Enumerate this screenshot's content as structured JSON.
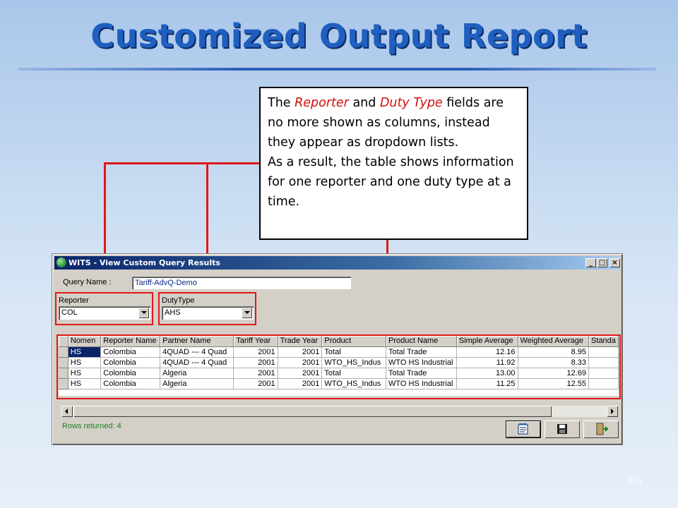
{
  "slide": {
    "title": "Customized Output Report",
    "page_number": "116",
    "callout": {
      "text_1": "The ",
      "red_1": "Reporter",
      "text_2": " and ",
      "red_2": "Duty Type",
      "text_3": " fields are no more shown as columns, instead they appear as dropdown lists.",
      "text_4": "As a result, the table shows information for one reporter and one duty type at a time."
    },
    "accent_colors": {
      "title": "#1f5fbf",
      "highlight_red": "#e01818"
    }
  },
  "window": {
    "title": "WITS - View Custom Query Results",
    "buttons": {
      "minimize": "_",
      "maximize": "□",
      "close": "×"
    },
    "query_name_label": "Query Name :",
    "query_name_value": "Tariff-AdvQ-Demo",
    "reporter": {
      "label": "Reporter",
      "value": "COL"
    },
    "duty_type": {
      "label": "DutyType",
      "value": "AHS"
    },
    "table": {
      "columns": [
        "Nomen",
        "Reporter Name",
        "Partner Name",
        "Tariff Year",
        "Trade Year",
        "Product",
        "Product Name",
        "Simple Average",
        "Weighted Average",
        "Standa"
      ],
      "rows": [
        [
          "HS",
          "Colombia",
          "4QUAD --- 4 Quad",
          "2001",
          "2001",
          " Total",
          "Total Trade",
          "12.16",
          "8.95",
          ""
        ],
        [
          "HS",
          "Colombia",
          "4QUAD --- 4 Quad",
          "2001",
          "2001",
          "WTO_HS_Indus",
          "WTO HS Industrial",
          "11.92",
          "8.33",
          ""
        ],
        [
          "HS",
          "Colombia",
          "Algeria",
          "2001",
          "2001",
          " Total",
          "Total Trade",
          "13.00",
          "12.69",
          ""
        ],
        [
          "HS",
          "Colombia",
          "Algeria",
          "2001",
          "2001",
          "WTO_HS_Indus",
          "WTO HS Industrial",
          "11.25",
          "12.55",
          ""
        ]
      ]
    },
    "status": "Rows returned: 4",
    "toolbar_icons": [
      "notepad-icon",
      "save-icon",
      "exit-icon"
    ]
  }
}
